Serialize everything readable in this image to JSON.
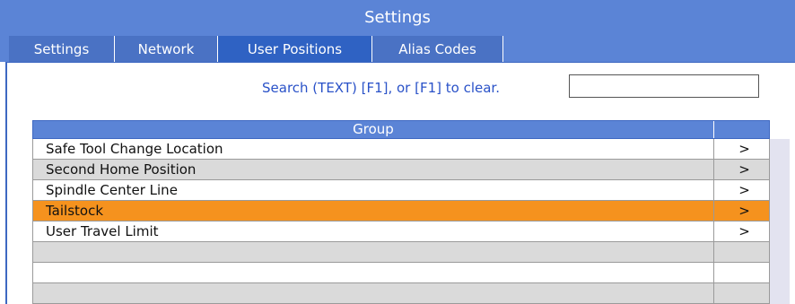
{
  "window": {
    "title": "Settings"
  },
  "tabs": [
    {
      "label": "Settings",
      "active": false
    },
    {
      "label": "Network",
      "active": false
    },
    {
      "label": "User Positions",
      "active": true
    },
    {
      "label": "Alias Codes",
      "active": false
    }
  ],
  "search": {
    "label": "Search (TEXT) [F1], or [F1] to clear.",
    "value": ""
  },
  "table": {
    "header": "Group",
    "rows": [
      {
        "name": "Safe Tool Change Location",
        "arrow": ">"
      },
      {
        "name": "Second Home Position",
        "arrow": ">"
      },
      {
        "name": "Spindle Center Line",
        "arrow": ">"
      },
      {
        "name": "Tailstock",
        "arrow": ">",
        "selected": true
      },
      {
        "name": "User Travel Limit",
        "arrow": ">"
      },
      {
        "name": "",
        "arrow": ""
      },
      {
        "name": "",
        "arrow": ""
      },
      {
        "name": "",
        "arrow": ""
      }
    ]
  },
  "colors": {
    "header_blue": "#5b84d6",
    "active_tab": "#2f62c3",
    "selected_row": "#f5921e",
    "search_label": "#2a52c8"
  }
}
